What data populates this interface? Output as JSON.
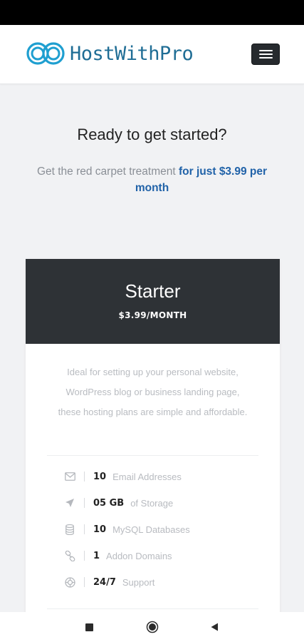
{
  "header": {
    "logo_text": "HostWithPro",
    "logo_icon": "double-loop-logo",
    "menu_icon": "hamburger-menu-icon"
  },
  "hero": {
    "title": "Ready to get started?",
    "subtitle_plain": "Get the red carpet treatment ",
    "subtitle_highlight": "for just $3.99 per month"
  },
  "plan": {
    "name": "Starter",
    "price": "$3.99/MONTH",
    "description": "Ideal for setting up your personal website, WordPress blog or business landing page, these hosting plans are simple and affordable.",
    "features": [
      {
        "icon": "envelope-icon",
        "value": "10",
        "label": "Email Addresses"
      },
      {
        "icon": "rocket-icon",
        "value": "05 GB",
        "label": "of Storage"
      },
      {
        "icon": "database-icon",
        "value": "10",
        "label": "MySQL Databases"
      },
      {
        "icon": "link-icon",
        "value": "1",
        "label": "Addon Domains"
      },
      {
        "icon": "lifebuoy-icon",
        "value": "24/7",
        "label": "Support"
      }
    ]
  },
  "system_nav": {
    "recents_icon": "square-icon",
    "home_icon": "circle-icon",
    "back_icon": "triangle-back-icon"
  },
  "colors": {
    "brand": "#1f6d95",
    "accent": "#2062a8",
    "card_header": "#2e3236",
    "page_bg": "#f1f2f4"
  }
}
